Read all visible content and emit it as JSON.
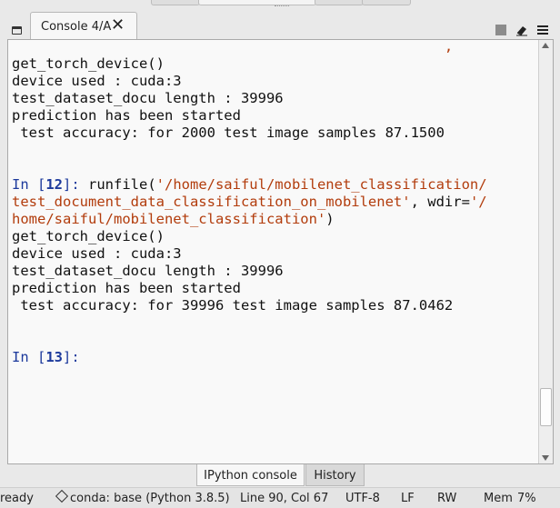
{
  "console_tab": {
    "label": "Console 4/A",
    "close_glyph": "✕"
  },
  "icons": [
    "tab-menu-icon",
    "stop-icon",
    "eraser-icon",
    "hamburger-menu-icon",
    "close-icon",
    "conda-cube-icon"
  ],
  "console": {
    "cut_line": "                                                   ,",
    "lines": [
      "get_torch_device()",
      "device used : cuda:3",
      "test_dataset_docu length : 39996",
      "prediction has been started",
      " test accuracy: for 2000 test image samples 87.1500",
      "",
      "",
      "get_torch_device()",
      "device used : cuda:3",
      "test_dataset_docu length : 39996",
      "prediction has been started",
      " test accuracy: for 39996 test image samples 87.0462"
    ],
    "cell12": {
      "prompt_pre": "In [",
      "prompt_num": "12",
      "prompt_post": "]: ",
      "code_pre": "runfile(",
      "str1": "'/home/saiful/mobilenet_classification/",
      "str2": "test_document_data_classification_on_mobilenet'",
      "code_mid": ", wdir=",
      "str3": "'/",
      "str4": "home/saiful/mobilenet_classification'",
      "code_end": ")"
    },
    "cell13": {
      "prompt_pre": "In [",
      "prompt_num": "13",
      "prompt_post": "]:"
    }
  },
  "bottom_tabs": {
    "ipython": "IPython console",
    "history": "History"
  },
  "status": {
    "ready": "ready",
    "env": "conda: base (Python 3.8.5)",
    "position": "Line 90, Col 67",
    "encoding": "UTF-8",
    "eol": "LF",
    "permissions": "RW",
    "mem_label": "Mem",
    "mem_value": "7%"
  }
}
